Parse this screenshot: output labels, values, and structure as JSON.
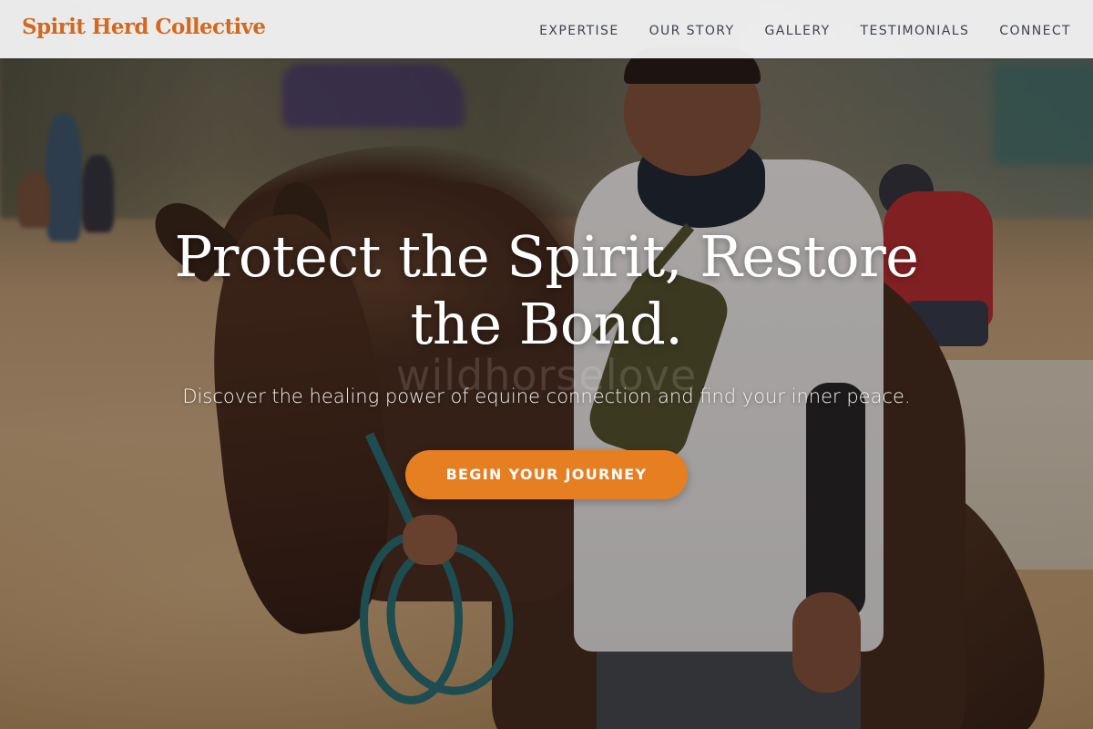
{
  "header": {
    "brand": "Spirit Herd Collective",
    "nav": [
      {
        "label": "EXPERTISE"
      },
      {
        "label": "OUR STORY"
      },
      {
        "label": "GALLERY"
      },
      {
        "label": "TESTIMONIALS"
      },
      {
        "label": "CONNECT"
      }
    ]
  },
  "hero": {
    "title": "Protect the Spirit, Restore the Bond.",
    "watermark": "wildhorselove",
    "subtitle": "Discover the healing power of equine connection and find your inner peace.",
    "cta_label": "BEGIN YOUR JOURNEY"
  },
  "colors": {
    "brand": "#d2691e",
    "cta": "#e67e22",
    "nav_text": "#3d4350"
  }
}
